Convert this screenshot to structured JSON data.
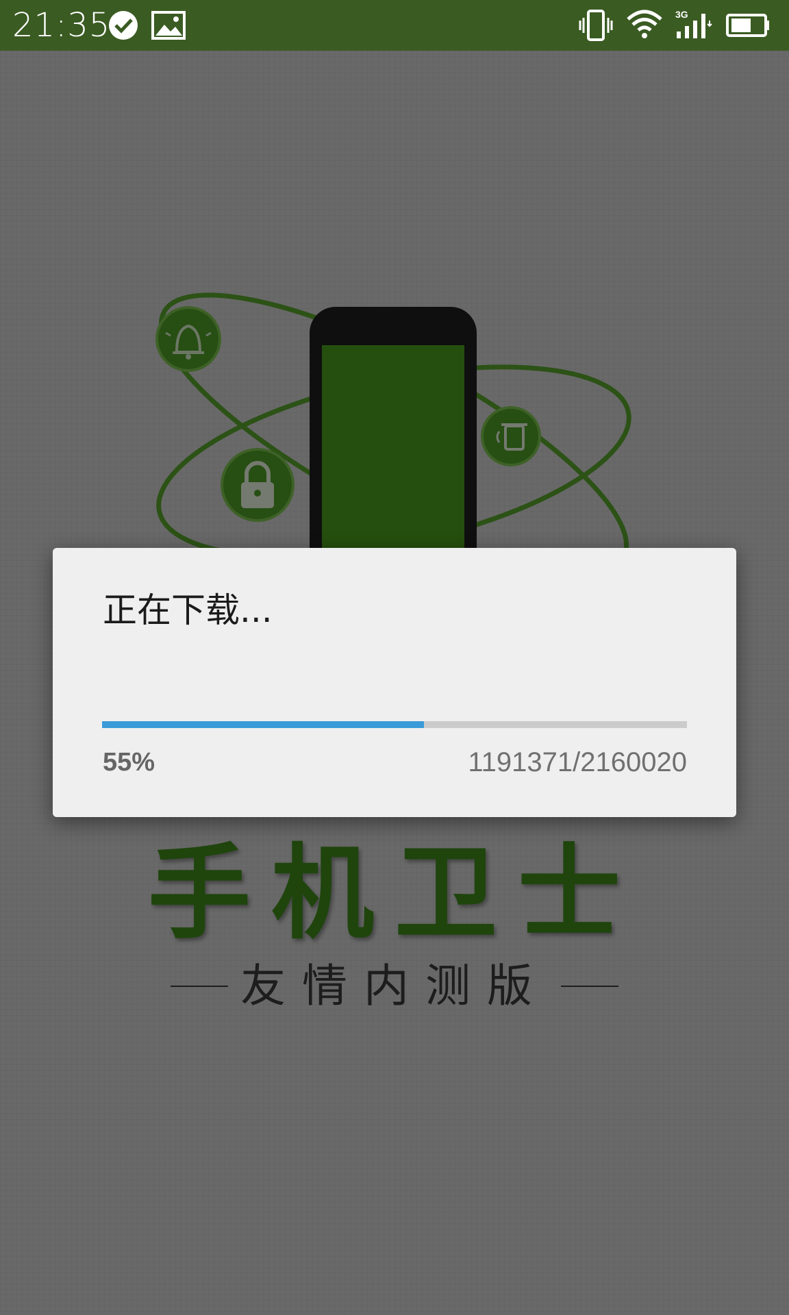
{
  "status_bar": {
    "time": "21:35",
    "color": "#3a5b22",
    "left_icons": [
      "check-circle-icon",
      "image-icon"
    ],
    "right_icons": [
      "vibrate-icon",
      "wifi-icon",
      "signal-3g-icon",
      "battery-icon"
    ],
    "network_label": "3G"
  },
  "background": {
    "brand_title": "手机卫士",
    "brand_subtitle": "友情内测版",
    "accent_color": "#3f8a1a",
    "illustration_icons": [
      "bell-icon",
      "lock-icon",
      "trash-icon",
      "phone-icon"
    ]
  },
  "dialog": {
    "title": "正在下载...",
    "progress": {
      "fraction": 0.55,
      "percent_label": "55%",
      "count_label": "1191371/2160020",
      "fill_color": "#3a9bd9",
      "track_color": "#cbcbcb"
    }
  }
}
